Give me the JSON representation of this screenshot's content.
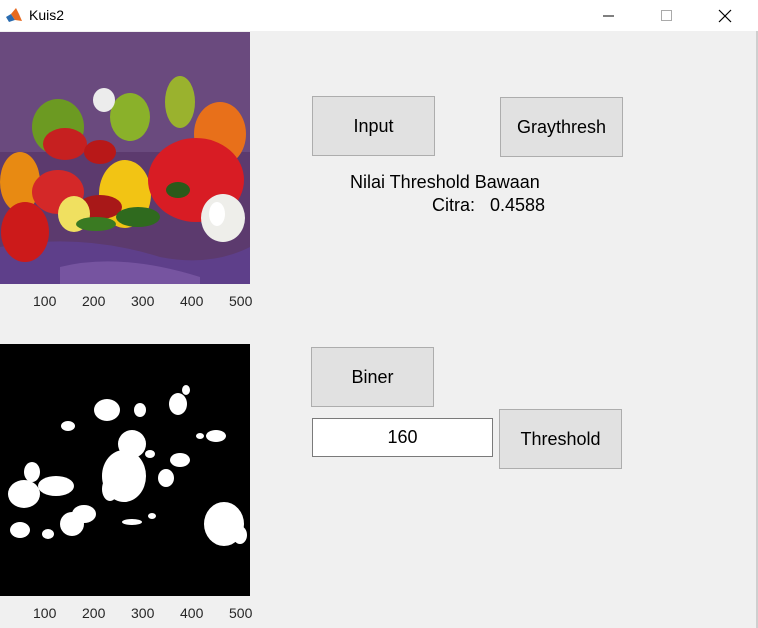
{
  "window": {
    "title": "Kuis2",
    "icon": "matlab-logo-icon",
    "controls": [
      "minimize-icon",
      "maximize-icon",
      "close-icon"
    ]
  },
  "axes_top": {
    "content": "color image of peppers and garlic",
    "x_ticks": [
      "100",
      "200",
      "300",
      "400",
      "500"
    ]
  },
  "axes_bottom": {
    "content": "binary thresholded image of peppers",
    "x_ticks": [
      "100",
      "200",
      "300",
      "400",
      "500"
    ]
  },
  "buttons": {
    "input": "Input",
    "graythresh": "Graythresh",
    "biner": "Biner",
    "threshold": "Threshold"
  },
  "labels": {
    "threshold_caption": "Nilai Threshold Bawaan",
    "citra_caption": "Citra:",
    "threshold_value": "0.4588"
  },
  "threshold_input": {
    "value": "160"
  },
  "colors": {
    "background": "#f0f0f0",
    "button": "#e1e1e1",
    "button_border": "#adadad",
    "matlab_orange": "#e76a1f"
  }
}
